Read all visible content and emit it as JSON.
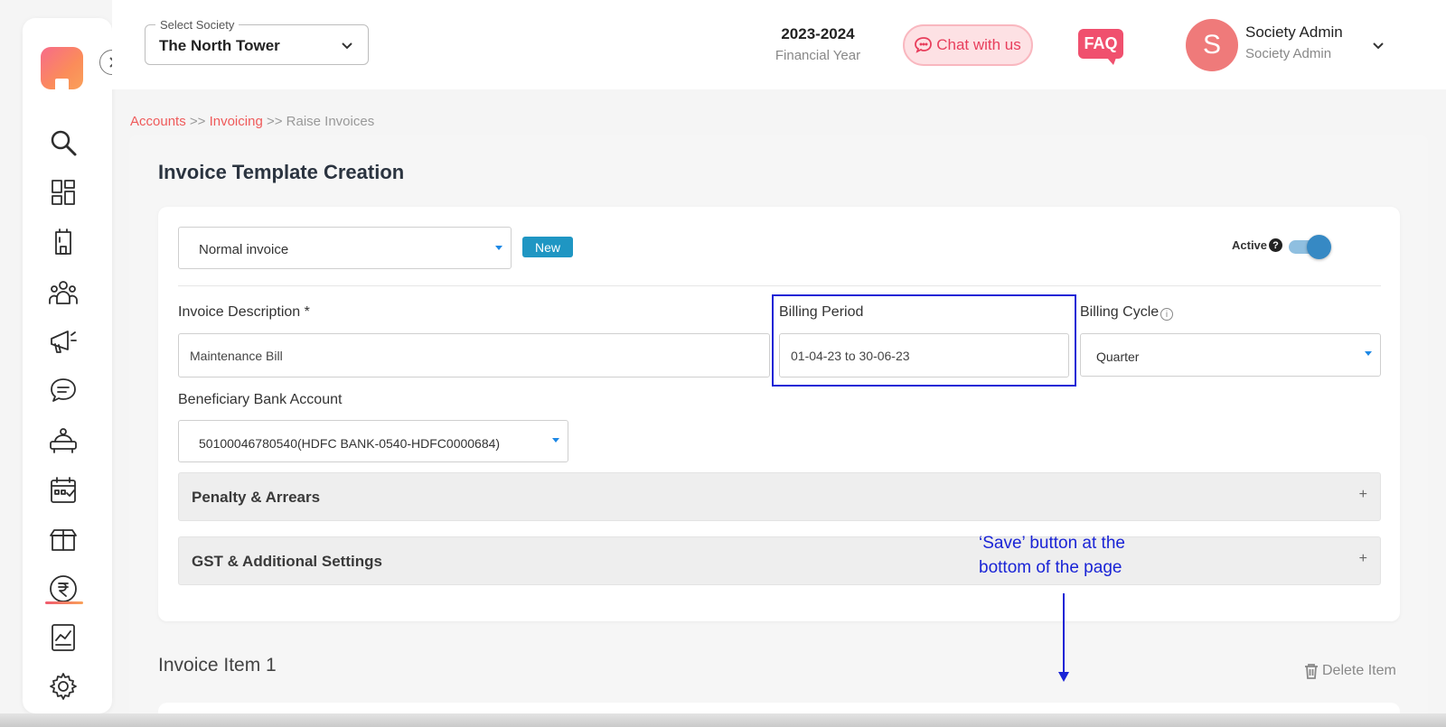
{
  "header": {
    "society_legend": "Select Society",
    "society_value": "The North Tower",
    "financial_year": "2023-2024",
    "financial_year_label": "Financial Year",
    "chat_label": "Chat with us",
    "faq_label": "FAQ",
    "avatar_initial": "S",
    "user_name": "Society Admin",
    "user_role": "Society Admin"
  },
  "sidebar": {
    "icons": [
      "search-icon",
      "dashboard-icon",
      "building-icon",
      "community-icon",
      "announcement-icon",
      "chat-icon",
      "amenities-icon",
      "calendar-icon",
      "store-icon",
      "rupee-icon",
      "reports-icon",
      "settings-icon"
    ],
    "active": "rupee-icon"
  },
  "breadcrumb": {
    "items": [
      "Accounts",
      "Invoicing",
      "Raise Invoices"
    ],
    "separator": ">>"
  },
  "page": {
    "title": "Invoice Template Creation"
  },
  "form": {
    "invoice_type": "Normal invoice",
    "new_badge": "New",
    "active_label": "Active",
    "active_help": "?",
    "active_state": true,
    "invoice_description_label": "Invoice Description *",
    "invoice_description_value": "Maintenance Bill",
    "billing_period_label": "Billing Period",
    "billing_period_value": "01-04-23 to 30-06-23",
    "billing_cycle_label": "Billing Cycle",
    "billing_cycle_info": "i",
    "billing_cycle_value": "Quarter",
    "bank_account_label": "Beneficiary Bank Account",
    "bank_account_value": "50100046780540(HDFC BANK-0540-HDFC0000684)"
  },
  "accordions": [
    {
      "title": "Penalty & Arrears",
      "icon": "+"
    },
    {
      "title": "GST & Additional Settings",
      "icon": "+"
    }
  ],
  "annotation": {
    "line1": "‘Save’ button at the",
    "line2": "bottom of the page",
    "color": "#1a24d6"
  },
  "invoice_item": {
    "title": "Invoice Item 1",
    "delete_label": "Delete Item"
  },
  "colors": {
    "accent": "#ef5a5a",
    "link_blue": "#1f96c3",
    "toggle": "#3689c4"
  }
}
